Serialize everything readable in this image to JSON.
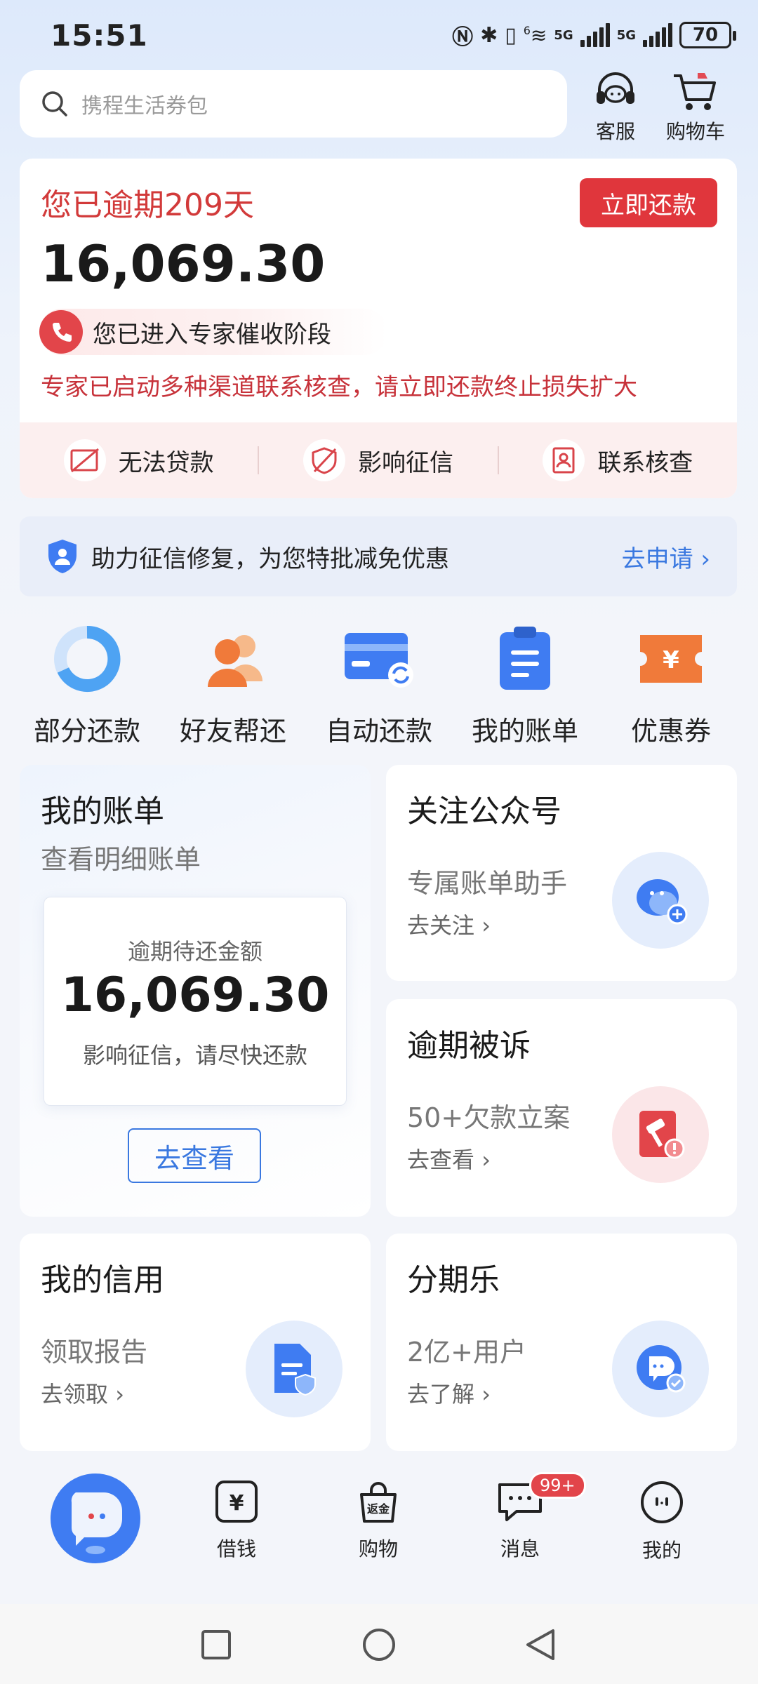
{
  "status_bar": {
    "time": "15:51",
    "network_1": "5G",
    "network_2": "5G",
    "battery": "70",
    "wifi_level": "6"
  },
  "search": {
    "placeholder": "携程生活券包"
  },
  "header_actions": {
    "service": "客服",
    "cart": "购物车"
  },
  "overdue": {
    "title": "您已逾期209天",
    "pay_button": "立即还款",
    "amount": "16,069.30",
    "stage": "您已进入专家催收阶段",
    "warning": "专家已启动多种渠道联系核查，请立即还款终止损失扩大",
    "consequences": [
      {
        "label": "无法贷款",
        "icon": "no-loan-icon"
      },
      {
        "label": "影响征信",
        "icon": "credit-impact-icon"
      },
      {
        "label": "联系核查",
        "icon": "contact-check-icon"
      }
    ]
  },
  "credit_banner": {
    "text": "助力征信修复，为您特批减免优惠",
    "link": "去申请"
  },
  "shortcuts": [
    {
      "label": "部分还款",
      "icon": "partial-repay-icon"
    },
    {
      "label": "好友帮还",
      "icon": "friend-help-icon"
    },
    {
      "label": "自动还款",
      "icon": "auto-repay-icon"
    },
    {
      "label": "我的账单",
      "icon": "my-bill-icon"
    },
    {
      "label": "优惠券",
      "icon": "coupon-icon"
    }
  ],
  "bill_card": {
    "title": "我的账单",
    "subtitle": "查看明细账单",
    "inner_label": "逾期待还金额",
    "inner_amount": "16,069.30",
    "inner_note": "影响征信，请尽快还款",
    "button": "去查看"
  },
  "follow_card": {
    "title": "关注公众号",
    "subtitle": "专属账单助手",
    "link": "去关注"
  },
  "sued_card": {
    "title": "逾期被诉",
    "subtitle": "50+欠款立案",
    "link": "去查看"
  },
  "credit_card": {
    "title": "我的信用",
    "subtitle": "领取报告",
    "link": "去领取"
  },
  "installment_card": {
    "title": "分期乐",
    "subtitle": "2亿+用户",
    "link": "去了解"
  },
  "bottom_nav": {
    "items": [
      {
        "label": "借钱",
        "icon": "yen-icon"
      },
      {
        "label": "购物",
        "icon": "shopping-bag-icon"
      },
      {
        "label": "消息",
        "icon": "message-icon",
        "badge": "99+"
      },
      {
        "label": "我的",
        "icon": "profile-icon"
      }
    ]
  },
  "colors": {
    "accent_red": "#e0363c",
    "link_blue": "#3a78e0",
    "brand_blue": "#3f7cf2",
    "coupon_orange": "#f07a3a"
  }
}
